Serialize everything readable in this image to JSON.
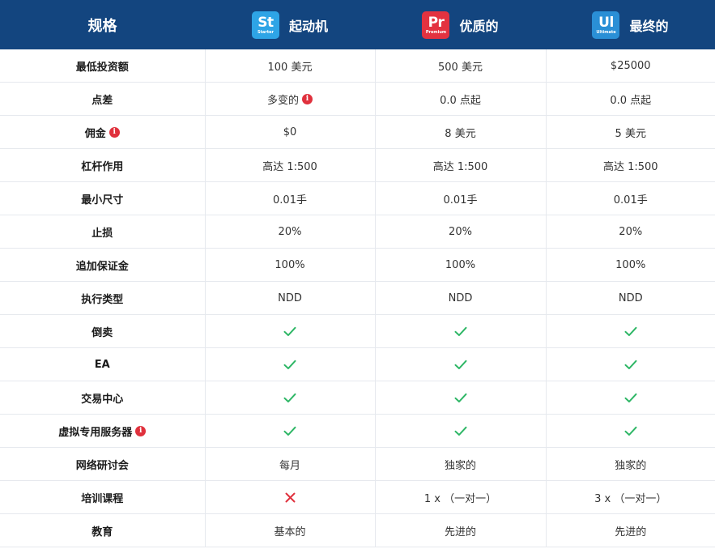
{
  "colors": {
    "header_bg": "#13457f",
    "starter_badge": "#2ea4e6",
    "premium_badge": "#e33240",
    "ultimate_badge": "#2a8fd6",
    "check": "#2db665",
    "cross": "#e0313d",
    "info": "#e0313d"
  },
  "header": {
    "spec_label": "规格",
    "plans": [
      {
        "abbr": "St",
        "tiny": "Starter",
        "name": "起动机"
      },
      {
        "abbr": "Pr",
        "tiny": "Premium",
        "name": "优质的"
      },
      {
        "abbr": "Ul",
        "tiny": "Ultimate",
        "name": "最终的"
      }
    ]
  },
  "rows": [
    {
      "label": "最低投资额",
      "info": false,
      "cells": [
        {
          "type": "text",
          "value": "100 美元"
        },
        {
          "type": "text",
          "value": "500 美元"
        },
        {
          "type": "text",
          "value": "$25000"
        }
      ]
    },
    {
      "label": "点差",
      "info": false,
      "cells": [
        {
          "type": "text",
          "value": "多变的",
          "info": true
        },
        {
          "type": "text",
          "value": "0.0 点起"
        },
        {
          "type": "text",
          "value": "0.0 点起"
        }
      ]
    },
    {
      "label": "佣金",
      "info": true,
      "cells": [
        {
          "type": "text",
          "value": "$0"
        },
        {
          "type": "text",
          "value": "8 美元"
        },
        {
          "type": "text",
          "value": "5 美元"
        }
      ]
    },
    {
      "label": "杠杆作用",
      "info": false,
      "cells": [
        {
          "type": "text",
          "value": "高达 1:500"
        },
        {
          "type": "text",
          "value": "高达 1:500"
        },
        {
          "type": "text",
          "value": "高达 1:500"
        }
      ]
    },
    {
      "label": "最小尺寸",
      "info": false,
      "cells": [
        {
          "type": "text",
          "value": "0.01手"
        },
        {
          "type": "text",
          "value": "0.01手"
        },
        {
          "type": "text",
          "value": "0.01手"
        }
      ]
    },
    {
      "label": "止损",
      "info": false,
      "cells": [
        {
          "type": "text",
          "value": "20%"
        },
        {
          "type": "text",
          "value": "20%"
        },
        {
          "type": "text",
          "value": "20%"
        }
      ]
    },
    {
      "label": "追加保证金",
      "info": false,
      "cells": [
        {
          "type": "text",
          "value": "100%"
        },
        {
          "type": "text",
          "value": "100%"
        },
        {
          "type": "text",
          "value": "100%"
        }
      ]
    },
    {
      "label": "执行类型",
      "info": false,
      "cells": [
        {
          "type": "text",
          "value": "NDD"
        },
        {
          "type": "text",
          "value": "NDD"
        },
        {
          "type": "text",
          "value": "NDD"
        }
      ]
    },
    {
      "label": "倒卖",
      "info": false,
      "cells": [
        {
          "type": "check"
        },
        {
          "type": "check"
        },
        {
          "type": "check"
        }
      ]
    },
    {
      "label": "EA",
      "info": false,
      "cells": [
        {
          "type": "check"
        },
        {
          "type": "check"
        },
        {
          "type": "check"
        }
      ]
    },
    {
      "label": "交易中心",
      "info": false,
      "cells": [
        {
          "type": "check"
        },
        {
          "type": "check"
        },
        {
          "type": "check"
        }
      ]
    },
    {
      "label": "虚拟专用服务器",
      "info": true,
      "cells": [
        {
          "type": "check"
        },
        {
          "type": "check"
        },
        {
          "type": "check"
        }
      ]
    },
    {
      "label": "网络研讨会",
      "info": false,
      "cells": [
        {
          "type": "text",
          "value": "每月"
        },
        {
          "type": "text",
          "value": "独家的"
        },
        {
          "type": "text",
          "value": "独家的"
        }
      ]
    },
    {
      "label": "培训课程",
      "info": false,
      "cells": [
        {
          "type": "cross"
        },
        {
          "type": "text",
          "value": "1 x （一对一）"
        },
        {
          "type": "text",
          "value": "3 x （一对一）"
        }
      ]
    },
    {
      "label": "教育",
      "info": false,
      "cells": [
        {
          "type": "text",
          "value": "基本的"
        },
        {
          "type": "text",
          "value": "先进的"
        },
        {
          "type": "text",
          "value": "先进的"
        }
      ]
    }
  ]
}
